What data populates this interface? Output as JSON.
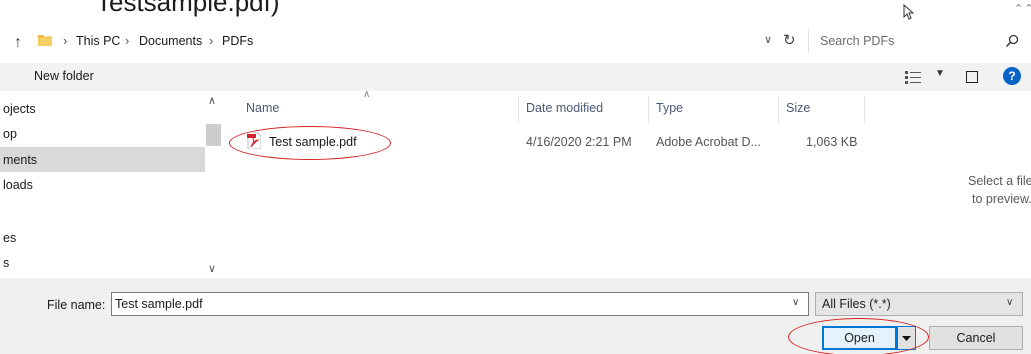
{
  "caption": {
    "text": "Testsample.pdf)"
  },
  "address_bar": {
    "crumbs": [
      "This PC",
      "Documents",
      "PDFs"
    ],
    "separator": "›",
    "search_placeholder": "Search PDFs"
  },
  "commands": {
    "new_folder": "New folder",
    "help": "?"
  },
  "nav": {
    "items": [
      "ojects",
      "op",
      "ments",
      "loads",
      "",
      "es",
      "s"
    ],
    "selected_index": 2
  },
  "columns": {
    "name": "Name",
    "date": "Date modified",
    "type": "Type",
    "size": "Size"
  },
  "files": [
    {
      "name": "Test sample.pdf",
      "date": "4/16/2020 2:21 PM",
      "type": "Adobe Acrobat D...",
      "size": "1,063 KB"
    }
  ],
  "preview": {
    "line1": "Select a file",
    "line2": "to preview."
  },
  "bottom": {
    "filename_label": "File name:",
    "filename_value": "Test sample.pdf",
    "filter_value": "All Files (*.*)",
    "open_label": "Open",
    "cancel_label": "Cancel"
  },
  "colors": {
    "annotation": "#d42020",
    "accent": "#0078d7",
    "help": "#0a63c9"
  }
}
